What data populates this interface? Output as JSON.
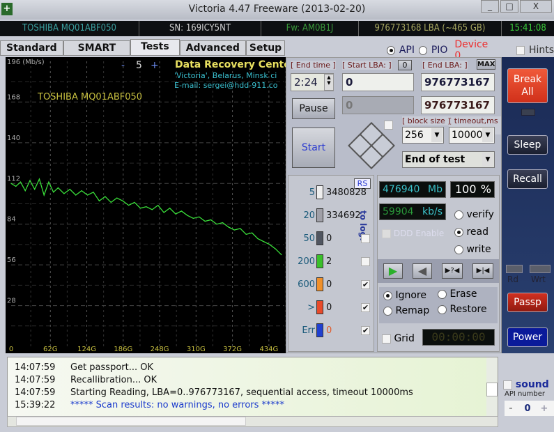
{
  "window": {
    "title": "Victoria 4.47  Freeware (2013-02-20)",
    "minimize": "_",
    "maximize": "□",
    "close": "X",
    "app_icon": "plus-icon"
  },
  "info": {
    "model": "TOSHIBA MQ01ABF050",
    "serial": "SN: 169ICY5NT",
    "firmware": "Fw: AM0B1J",
    "lba": "976773168 LBA (~465 GB)",
    "clock": "15:41:08"
  },
  "tabs": [
    {
      "label": "Standard"
    },
    {
      "label": "SMART"
    },
    {
      "label": "Tests",
      "active": true
    },
    {
      "label": "Advanced"
    },
    {
      "label": "Setup"
    }
  ],
  "modes": {
    "api": "API",
    "pio": "PIO",
    "device": "Device 0",
    "hints": "Hints",
    "api_selected": true
  },
  "chart_data": {
    "type": "line",
    "ylabel": "196 (Mb/s)",
    "ylim": [
      0,
      196
    ],
    "yticks": [
      "28",
      "56",
      "84",
      "112",
      "140",
      "168"
    ],
    "xticks": [
      "0",
      "62G",
      "124G",
      "186G",
      "248G",
      "310G",
      "372G",
      "434G"
    ],
    "xlim": [
      0,
      465
    ],
    "grid": true,
    "color": "#3adf3a",
    "drive_label": "TOSHIBA MQ01ABF050",
    "scale_minus": "-",
    "scale_value": "5",
    "scale_plus": "+",
    "banner": {
      "title": "Data Recovery Center:",
      "line1": "'Victoria', Belarus, Minsk ci",
      "line2": "E-mail: sergei@hdd-911.co"
    },
    "x": [
      0,
      8,
      16,
      24,
      32,
      40,
      48,
      56,
      64,
      72,
      80,
      90,
      100,
      110,
      120,
      130,
      140,
      150,
      160,
      170,
      180,
      190,
      200,
      210,
      220,
      230,
      240,
      250,
      260,
      270,
      280,
      290,
      300,
      310,
      320,
      330,
      340,
      350,
      360,
      370,
      380,
      390,
      400,
      410,
      420,
      430,
      440,
      450,
      460
    ],
    "y": [
      112,
      110,
      113,
      107,
      114,
      108,
      115,
      104,
      113,
      106,
      109,
      105,
      108,
      104,
      107,
      104,
      106,
      100,
      103,
      99,
      102,
      100,
      97,
      99,
      95,
      96,
      94,
      97,
      92,
      95,
      91,
      93,
      90,
      88,
      89,
      86,
      87,
      84,
      85,
      82,
      80,
      81,
      77,
      78,
      74,
      72,
      70,
      67,
      63
    ]
  },
  "controls": {
    "end_time_label": "[ End time ]",
    "end_time": "2:24",
    "start_lba_label": "[ Start LBA: ]",
    "start_lba_zero": "0",
    "end_lba_label": "[ End LBA: ]",
    "max": "MAX",
    "start_lba": "0",
    "end_lba": "976773167",
    "current_lba": "0",
    "end_lba2": "976773167",
    "pause": "Pause",
    "start": "Start",
    "block_size_label": "[ block size ]",
    "timeout_label": "[ timeout,ms ]",
    "block_size": "256",
    "timeout": "10000",
    "end_action": "End of test"
  },
  "stats": {
    "rs": "RS",
    "to_log": "to log:",
    "rows": [
      {
        "label": "5",
        "count": "3480828",
        "color": "#eeeeee",
        "log": null
      },
      {
        "label": "20",
        "count": "334692",
        "color": "#a0a0a8",
        "log": null
      },
      {
        "label": "50",
        "count": "0",
        "color": "#505560",
        "log": false
      },
      {
        "label": "200",
        "count": "2",
        "color": "#3ac02a",
        "log": false
      },
      {
        "label": "600",
        "count": "0",
        "color": "#f0902a",
        "log": true
      },
      {
        "label": ">",
        "count": "0",
        "color": "#e84a2a",
        "log": true
      },
      {
        "label": "Err",
        "count": "0",
        "color": "#2040d0",
        "log": true
      }
    ]
  },
  "progress": {
    "mb": "476940",
    "mb_unit": "Mb",
    "percent": "100",
    "percent_unit": "%",
    "speed": "59904",
    "speed_unit": "kb/s",
    "ddd": "DDD Enable",
    "verify": "verify",
    "read": "read",
    "write": "write",
    "mode": "read"
  },
  "playback": {
    "play": "▶",
    "back": "◀",
    "skip_q": "▶?◀",
    "skip": "▶|◀"
  },
  "actions": {
    "ignore": "Ignore",
    "erase": "Erase",
    "remap": "Remap",
    "restore": "Restore",
    "selected": "Ignore",
    "grid": "Grid",
    "timer": "00:00:00"
  },
  "side": {
    "break_all": "Break All",
    "sleep": "Sleep",
    "recall": "Recall",
    "rd": "Rd",
    "wrt": "Wrt",
    "passp": "Passp",
    "power": "Power",
    "sound": "sound",
    "api_number_label": "API number",
    "api_minus": "-",
    "api_number": "0",
    "api_plus": "+"
  },
  "log": [
    {
      "time": "14:07:59",
      "text": "Get passport... OK",
      "color": "#111111"
    },
    {
      "time": "14:07:59",
      "text": "Recallibration... OK",
      "color": "#111111"
    },
    {
      "time": "14:07:59",
      "text": "Starting Reading, LBA=0..976773167, sequential access, timeout 10000ms",
      "color": "#111111"
    },
    {
      "time": "15:39:22",
      "text": "***** Scan results: no warnings, no errors *****",
      "color": "#1a3acc"
    }
  ]
}
